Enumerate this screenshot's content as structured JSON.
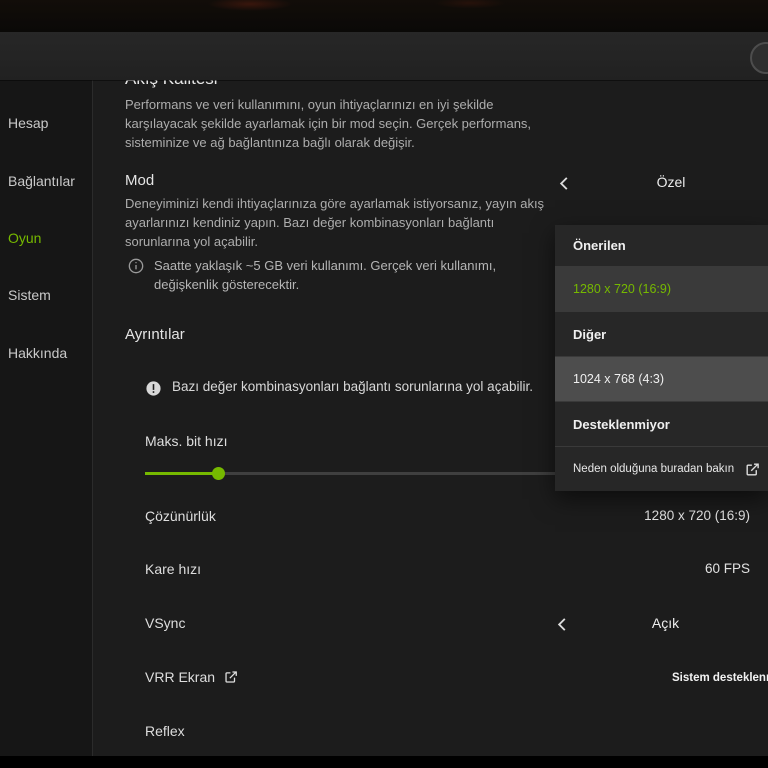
{
  "sidebar": {
    "items": [
      {
        "label": "Hesap",
        "active": false
      },
      {
        "label": "Bağlantılar",
        "active": false
      },
      {
        "label": "Oyun",
        "active": true
      },
      {
        "label": "Sistem",
        "active": false
      },
      {
        "label": "Hakkında",
        "active": false
      }
    ]
  },
  "stream_quality": {
    "title": "Akış Kalitesi",
    "description": "Performans ve veri kullanımını, oyun ihtiyaçlarınızı en iyi şekilde karşılayacak şekilde ayarlamak için bir mod seçin. Gerçek performans, sisteminize ve ağ bağlantınıza bağlı olarak değişir."
  },
  "mode": {
    "label": "Mod",
    "description": "Deneyiminizi kendi ihtiyaçlarınıza göre ayarlamak istiyorsanız, yayın akış ayarlarınızı kendiniz yapın. Bazı değer kombinasyonları bağlantı sorunlarına yol açabilir.",
    "data_usage_note": "Saatte yaklaşık ~5 GB veri kullanımı. Gerçek veri kullanımı, değişkenlik gösterecektir.",
    "value": "Özel"
  },
  "details": {
    "title": "Ayrıntılar",
    "warning": "Bazı değer kombinasyonları bağlantı sorunlarına yol açabilir.",
    "max_bitrate_label": "Maks. bit hızı",
    "resolution_label": "Çözünürlük",
    "resolution_value": "1280 x 720 (16:9)",
    "framerate_label": "Kare hızı",
    "framerate_value": "60 FPS",
    "vsync_label": "VSync",
    "vsync_value": "Açık",
    "vrr_label": "VRR Ekran",
    "vrr_value": "Sistem desteklenm",
    "reflex_label": "Reflex"
  },
  "resolution_dropdown": {
    "recommended_header": "Önerilen",
    "recommended_option": "1280 x 720 (16:9)",
    "other_header": "Diğer",
    "other_option": "1024 x 768 (4:3)",
    "unsupported_header": "Desteklenmiyor",
    "footer_link": "Neden olduğuna buradan bakın"
  },
  "slider": {
    "value_percent": 12
  },
  "colors": {
    "accent_green": "#76b900"
  }
}
